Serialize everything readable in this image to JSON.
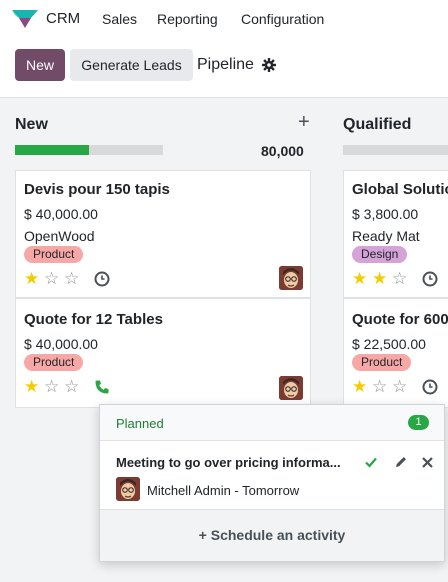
{
  "navbar": {
    "app_name": "CRM",
    "menus": [
      "Sales",
      "Reporting",
      "Configuration"
    ]
  },
  "control_panel": {
    "new_label": "New",
    "generate_label": "Generate Leads",
    "breadcrumb": "Pipeline"
  },
  "columns": [
    {
      "title": "New",
      "total": "80,000",
      "progress_fraction": 0.5,
      "cards": [
        {
          "title": "Devis pour 150 tapis",
          "amount": "$ 40,000.00",
          "company": "OpenWood",
          "tag": "Product",
          "stars": 1,
          "activity_icon": "clock-icon"
        },
        {
          "title": "Quote for 12 Tables",
          "amount": "$ 40,000.00",
          "company": "",
          "tag": "Product",
          "stars": 1,
          "activity_icon": "phone-icon"
        }
      ]
    },
    {
      "title": "Qualified",
      "cards": [
        {
          "title": "Global Solutio",
          "amount": "$ 3,800.00",
          "company": "Ready Mat",
          "tag": "Design",
          "stars": 2,
          "activity_icon": "clock-icon"
        },
        {
          "title": "Quote for 600",
          "amount": "$ 22,500.00",
          "company": "",
          "tag": "Product",
          "stars": 1,
          "activity_icon": "clock-icon"
        }
      ]
    }
  ],
  "popover": {
    "section_title": "Planned",
    "count": "1",
    "activity_summary": "Meeting to go over pricing informa...",
    "user_line": "Mitchell Admin - Tomorrow",
    "schedule_label": "Schedule an activity"
  },
  "colors": {
    "brand": "#714b67",
    "success": "#28a745",
    "star": "#f3cc00",
    "tag_product": "#f8a7a7",
    "tag_design": "#d5a3d8"
  }
}
